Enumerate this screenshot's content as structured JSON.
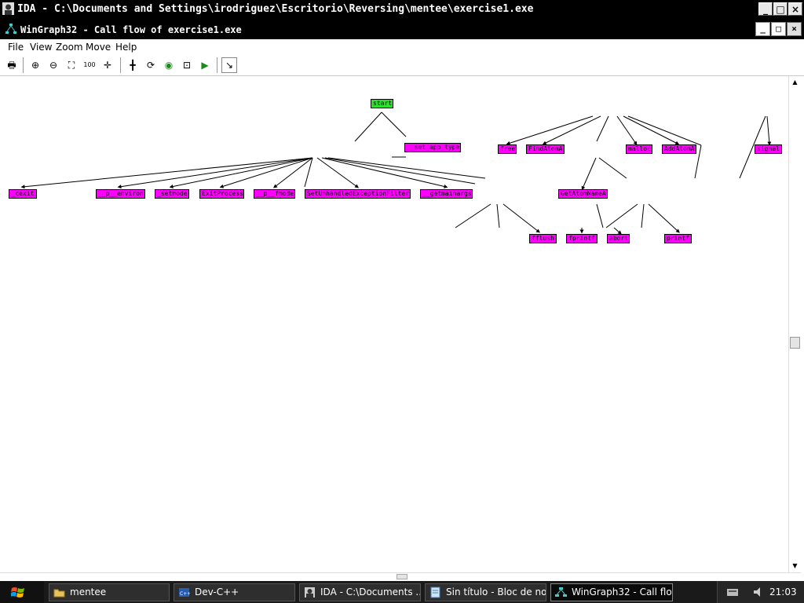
{
  "ida_window": {
    "title": "IDA - C:\\Documents and Settings\\irodriguez\\Escritorio\\Reversing\\mentee\\exercise1.exe",
    "controls": [
      "_",
      "□",
      "×"
    ]
  },
  "wingraph_window": {
    "title": "WinGraph32 - Call flow of exercise1.exe",
    "controls": [
      "_",
      "□",
      "×"
    ]
  },
  "menubar": [
    {
      "label": "File"
    },
    {
      "label": "View"
    },
    {
      "label": "Zoom"
    },
    {
      "label": "Move"
    },
    {
      "label": "Help"
    }
  ],
  "toolbar": [
    {
      "icon": "print-icon",
      "glyph": "🖶"
    },
    {
      "icon": "zoom-in-icon",
      "glyph": "⊕"
    },
    {
      "icon": "zoom-out-icon",
      "glyph": "⊖"
    },
    {
      "icon": "fit-window-icon",
      "glyph": "⛶"
    },
    {
      "icon": "zoom-100-icon",
      "glyph": "100"
    },
    {
      "icon": "center-icon",
      "glyph": "✛"
    },
    {
      "icon": "north-icon",
      "glyph": "╋"
    },
    {
      "icon": "rotate-icon",
      "glyph": "⟳"
    },
    {
      "icon": "layout-icon",
      "glyph": "◉"
    },
    {
      "icon": "fisheye-icon",
      "glyph": "⊡"
    },
    {
      "icon": "next-node-icon",
      "glyph": "▶"
    },
    {
      "icon": "follow-edge-icon",
      "glyph": "↘"
    }
  ],
  "graph": {
    "node_colors": {
      "start": "#2ee02e",
      "function": "#ff00ff"
    },
    "nodes": [
      {
        "id": "start",
        "label": "start",
        "kind": "start"
      },
      {
        "id": "set_app_type",
        "label": "__set_app_type",
        "kind": "function"
      },
      {
        "id": "free",
        "label": "free",
        "kind": "function"
      },
      {
        "id": "FindAtomA",
        "label": "FindAtomA",
        "kind": "function"
      },
      {
        "id": "malloc",
        "label": "malloc",
        "kind": "function"
      },
      {
        "id": "AddAtomA",
        "label": "AddAtomA",
        "kind": "function"
      },
      {
        "id": "signal",
        "label": "signal",
        "kind": "function"
      },
      {
        "id": "cexit",
        "label": "_cexit",
        "kind": "function"
      },
      {
        "id": "p_environ",
        "label": "__p__environ",
        "kind": "function"
      },
      {
        "id": "setmode",
        "label": "_setmode",
        "kind": "function"
      },
      {
        "id": "ExitProcess",
        "label": "ExitProcess",
        "kind": "function"
      },
      {
        "id": "p_fmode",
        "label": "__p__fmode",
        "kind": "function"
      },
      {
        "id": "SetUnhandledExceptionFilter",
        "label": "SetUnhandledExceptionFilter",
        "kind": "function"
      },
      {
        "id": "getmainargs",
        "label": "__getmainargs",
        "kind": "function"
      },
      {
        "id": "GetAtomNameA",
        "label": "GetAtomNameA",
        "kind": "function"
      },
      {
        "id": "fflush",
        "label": "fflush",
        "kind": "function"
      },
      {
        "id": "fprintf",
        "label": "fprintf",
        "kind": "function"
      },
      {
        "id": "abort",
        "label": "abort",
        "kind": "function"
      },
      {
        "id": "printf",
        "label": "printf",
        "kind": "function"
      }
    ]
  },
  "taskbar": {
    "start_icon": "windows-logo-icon",
    "tasks": [
      {
        "label": "mentee",
        "icon": "folder-icon"
      },
      {
        "label": "Dev-C++",
        "icon": "devcpp-icon"
      },
      {
        "label": "IDA - C:\\Documents ...",
        "icon": "ida-icon"
      },
      {
        "label": "Sin título - Bloc de notas",
        "icon": "notepad-icon"
      },
      {
        "label": "WinGraph32 - Call flo...",
        "icon": "wingraph-icon",
        "active": true
      }
    ],
    "clock": "21:03"
  }
}
